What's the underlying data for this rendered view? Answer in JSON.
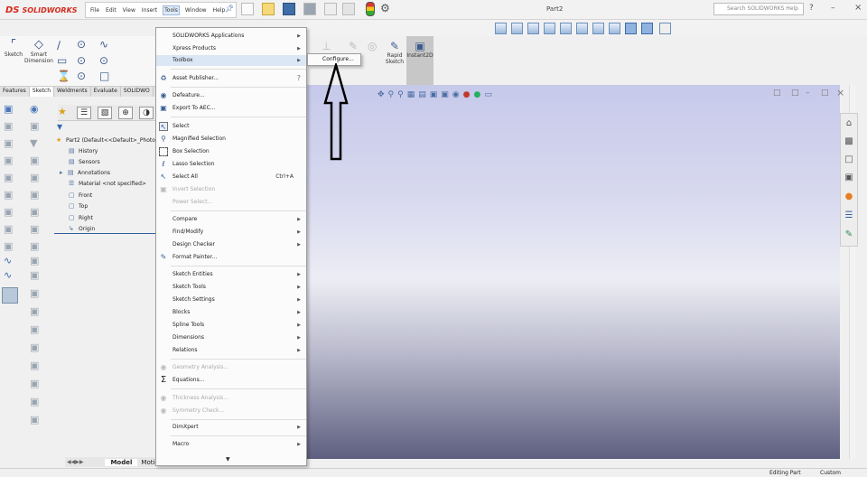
{
  "app": {
    "name": "SOLIDWORKS",
    "document_title": "Part2"
  },
  "menubar": {
    "items": [
      "File",
      "Edit",
      "View",
      "Insert",
      "Tools",
      "Window",
      "Help"
    ],
    "active_index": 4
  },
  "search": {
    "placeholder": "Search SOLIDWORKS Help"
  },
  "command_manager": {
    "sketch_label": "Sketch",
    "smart_dimension_label_1": "Smart",
    "smart_dimension_label_2": "Dimension",
    "rapid_sketch_label_1": "Rapid",
    "rapid_sketch_label_2": "Sketch",
    "instant2d_label": "Instant2D"
  },
  "tabs": [
    "Features",
    "Sketch",
    "Weldments",
    "Evaluate",
    "SOLIDWO"
  ],
  "active_tab_index": 1,
  "feature_tree": {
    "part": "Part2  (Default<<Default>_Photo",
    "items": [
      "History",
      "Sensors",
      "Annotations",
      "Material <not specified>",
      "Front",
      "Top",
      "Right",
      "Origin"
    ]
  },
  "bottom_tabs": [
    "Model",
    "Motion"
  ],
  "status": {
    "left": "Editing Part",
    "right": "Custom"
  },
  "tools_menu": {
    "items": [
      {
        "label": "SOLIDWORKS Applications",
        "submenu": true,
        "disabled": false
      },
      {
        "label": "Xpress Products",
        "submenu": true,
        "disabled": false
      },
      {
        "label": "Toolbox",
        "submenu": true,
        "disabled": false
      },
      {
        "label": "Asset Publisher...",
        "submenu": false,
        "disabled": false
      },
      {
        "label": "Defeature...",
        "submenu": false,
        "disabled": false
      },
      {
        "label": "Export To AEC...",
        "submenu": false,
        "disabled": false
      },
      {
        "label": "Select",
        "submenu": false,
        "disabled": false
      },
      {
        "label": "Magnified Selection",
        "submenu": false,
        "disabled": false
      },
      {
        "label": "Box Selection",
        "submenu": false,
        "disabled": false
      },
      {
        "label": "Lasso Selection",
        "submenu": false,
        "disabled": false
      },
      {
        "label": "Select All",
        "submenu": false,
        "disabled": false,
        "shortcut": "Ctrl+A"
      },
      {
        "label": "Invert Selection",
        "submenu": false,
        "disabled": true
      },
      {
        "label": "Power Select...",
        "submenu": false,
        "disabled": true
      },
      {
        "label": "Compare",
        "submenu": true,
        "disabled": false
      },
      {
        "label": "Find/Modify",
        "submenu": true,
        "disabled": false
      },
      {
        "label": "Design Checker",
        "submenu": true,
        "disabled": false
      },
      {
        "label": "Format Painter...",
        "submenu": false,
        "disabled": false
      },
      {
        "label": "Sketch Entities",
        "submenu": true,
        "disabled": false
      },
      {
        "label": "Sketch Tools",
        "submenu": true,
        "disabled": false
      },
      {
        "label": "Sketch Settings",
        "submenu": true,
        "disabled": false
      },
      {
        "label": "Blocks",
        "submenu": true,
        "disabled": false
      },
      {
        "label": "Spline Tools",
        "submenu": true,
        "disabled": false
      },
      {
        "label": "Dimensions",
        "submenu": true,
        "disabled": false
      },
      {
        "label": "Relations",
        "submenu": true,
        "disabled": false
      },
      {
        "label": "Geometry Analysis...",
        "submenu": false,
        "disabled": true
      },
      {
        "label": "Equations...",
        "submenu": false,
        "disabled": false
      },
      {
        "label": "Thickness Analysis...",
        "submenu": false,
        "disabled": true
      },
      {
        "label": "Symmetry Check...",
        "submenu": false,
        "disabled": true
      },
      {
        "label": "DimXpert",
        "submenu": true,
        "disabled": false
      },
      {
        "label": "Macro",
        "submenu": true,
        "disabled": false
      }
    ]
  },
  "toolbox_submenu": {
    "label": "Configure..."
  },
  "colors": {
    "accent": "#d52b1e",
    "highlight": "#dce7f5",
    "viewport_top": "#c6c9ea",
    "viewport_bottom": "#5e5f80"
  }
}
